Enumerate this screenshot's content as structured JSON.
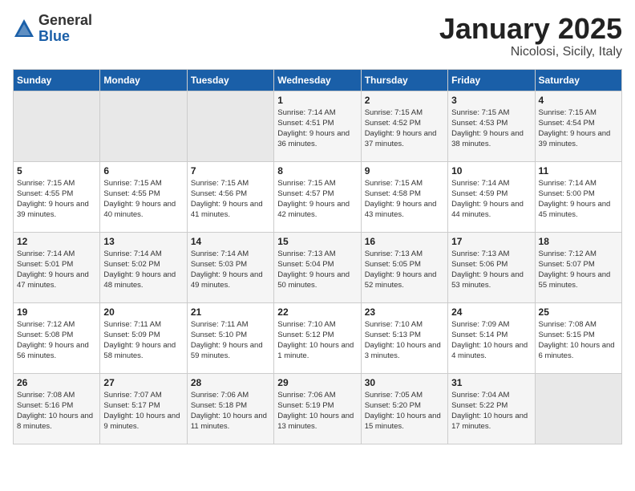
{
  "logo": {
    "general": "General",
    "blue": "Blue"
  },
  "title": "January 2025",
  "subtitle": "Nicolosi, Sicily, Italy",
  "weekdays": [
    "Sunday",
    "Monday",
    "Tuesday",
    "Wednesday",
    "Thursday",
    "Friday",
    "Saturday"
  ],
  "weeks": [
    [
      {
        "day": "",
        "info": ""
      },
      {
        "day": "",
        "info": ""
      },
      {
        "day": "",
        "info": ""
      },
      {
        "day": "1",
        "info": "Sunrise: 7:14 AM\nSunset: 4:51 PM\nDaylight: 9 hours and 36 minutes."
      },
      {
        "day": "2",
        "info": "Sunrise: 7:15 AM\nSunset: 4:52 PM\nDaylight: 9 hours and 37 minutes."
      },
      {
        "day": "3",
        "info": "Sunrise: 7:15 AM\nSunset: 4:53 PM\nDaylight: 9 hours and 38 minutes."
      },
      {
        "day": "4",
        "info": "Sunrise: 7:15 AM\nSunset: 4:54 PM\nDaylight: 9 hours and 39 minutes."
      }
    ],
    [
      {
        "day": "5",
        "info": "Sunrise: 7:15 AM\nSunset: 4:55 PM\nDaylight: 9 hours and 39 minutes."
      },
      {
        "day": "6",
        "info": "Sunrise: 7:15 AM\nSunset: 4:55 PM\nDaylight: 9 hours and 40 minutes."
      },
      {
        "day": "7",
        "info": "Sunrise: 7:15 AM\nSunset: 4:56 PM\nDaylight: 9 hours and 41 minutes."
      },
      {
        "day": "8",
        "info": "Sunrise: 7:15 AM\nSunset: 4:57 PM\nDaylight: 9 hours and 42 minutes."
      },
      {
        "day": "9",
        "info": "Sunrise: 7:15 AM\nSunset: 4:58 PM\nDaylight: 9 hours and 43 minutes."
      },
      {
        "day": "10",
        "info": "Sunrise: 7:14 AM\nSunset: 4:59 PM\nDaylight: 9 hours and 44 minutes."
      },
      {
        "day": "11",
        "info": "Sunrise: 7:14 AM\nSunset: 5:00 PM\nDaylight: 9 hours and 45 minutes."
      }
    ],
    [
      {
        "day": "12",
        "info": "Sunrise: 7:14 AM\nSunset: 5:01 PM\nDaylight: 9 hours and 47 minutes."
      },
      {
        "day": "13",
        "info": "Sunrise: 7:14 AM\nSunset: 5:02 PM\nDaylight: 9 hours and 48 minutes."
      },
      {
        "day": "14",
        "info": "Sunrise: 7:14 AM\nSunset: 5:03 PM\nDaylight: 9 hours and 49 minutes."
      },
      {
        "day": "15",
        "info": "Sunrise: 7:13 AM\nSunset: 5:04 PM\nDaylight: 9 hours and 50 minutes."
      },
      {
        "day": "16",
        "info": "Sunrise: 7:13 AM\nSunset: 5:05 PM\nDaylight: 9 hours and 52 minutes."
      },
      {
        "day": "17",
        "info": "Sunrise: 7:13 AM\nSunset: 5:06 PM\nDaylight: 9 hours and 53 minutes."
      },
      {
        "day": "18",
        "info": "Sunrise: 7:12 AM\nSunset: 5:07 PM\nDaylight: 9 hours and 55 minutes."
      }
    ],
    [
      {
        "day": "19",
        "info": "Sunrise: 7:12 AM\nSunset: 5:08 PM\nDaylight: 9 hours and 56 minutes."
      },
      {
        "day": "20",
        "info": "Sunrise: 7:11 AM\nSunset: 5:09 PM\nDaylight: 9 hours and 58 minutes."
      },
      {
        "day": "21",
        "info": "Sunrise: 7:11 AM\nSunset: 5:10 PM\nDaylight: 9 hours and 59 minutes."
      },
      {
        "day": "22",
        "info": "Sunrise: 7:10 AM\nSunset: 5:12 PM\nDaylight: 10 hours and 1 minute."
      },
      {
        "day": "23",
        "info": "Sunrise: 7:10 AM\nSunset: 5:13 PM\nDaylight: 10 hours and 3 minutes."
      },
      {
        "day": "24",
        "info": "Sunrise: 7:09 AM\nSunset: 5:14 PM\nDaylight: 10 hours and 4 minutes."
      },
      {
        "day": "25",
        "info": "Sunrise: 7:08 AM\nSunset: 5:15 PM\nDaylight: 10 hours and 6 minutes."
      }
    ],
    [
      {
        "day": "26",
        "info": "Sunrise: 7:08 AM\nSunset: 5:16 PM\nDaylight: 10 hours and 8 minutes."
      },
      {
        "day": "27",
        "info": "Sunrise: 7:07 AM\nSunset: 5:17 PM\nDaylight: 10 hours and 9 minutes."
      },
      {
        "day": "28",
        "info": "Sunrise: 7:06 AM\nSunset: 5:18 PM\nDaylight: 10 hours and 11 minutes."
      },
      {
        "day": "29",
        "info": "Sunrise: 7:06 AM\nSunset: 5:19 PM\nDaylight: 10 hours and 13 minutes."
      },
      {
        "day": "30",
        "info": "Sunrise: 7:05 AM\nSunset: 5:20 PM\nDaylight: 10 hours and 15 minutes."
      },
      {
        "day": "31",
        "info": "Sunrise: 7:04 AM\nSunset: 5:22 PM\nDaylight: 10 hours and 17 minutes."
      },
      {
        "day": "",
        "info": ""
      }
    ]
  ]
}
